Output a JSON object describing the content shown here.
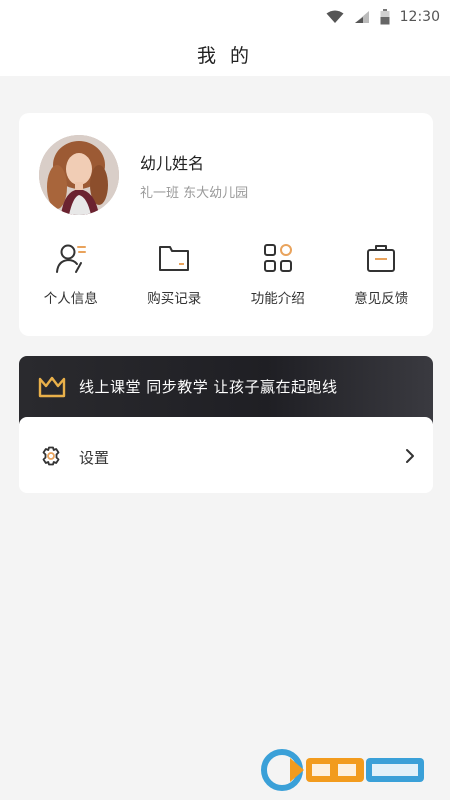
{
  "status_bar": {
    "time": "12:30"
  },
  "header": {
    "title": "我 的"
  },
  "profile": {
    "name": "幼儿姓名",
    "class_school": "礼一班 东大幼儿园"
  },
  "actions": [
    {
      "label": "个人信息",
      "icon": "person-icon"
    },
    {
      "label": "购买记录",
      "icon": "folder-icon"
    },
    {
      "label": "功能介绍",
      "icon": "grid-icon"
    },
    {
      "label": "意见反馈",
      "icon": "bag-icon"
    }
  ],
  "banner": {
    "text": "线上课堂 同步教学 让孩子赢在起跑线",
    "accent_color": "#e9b04a"
  },
  "settings": {
    "label": "设置"
  },
  "colors": {
    "page_bg": "#f4f4f4",
    "card_bg": "#ffffff",
    "accent": "#e9a35c"
  }
}
